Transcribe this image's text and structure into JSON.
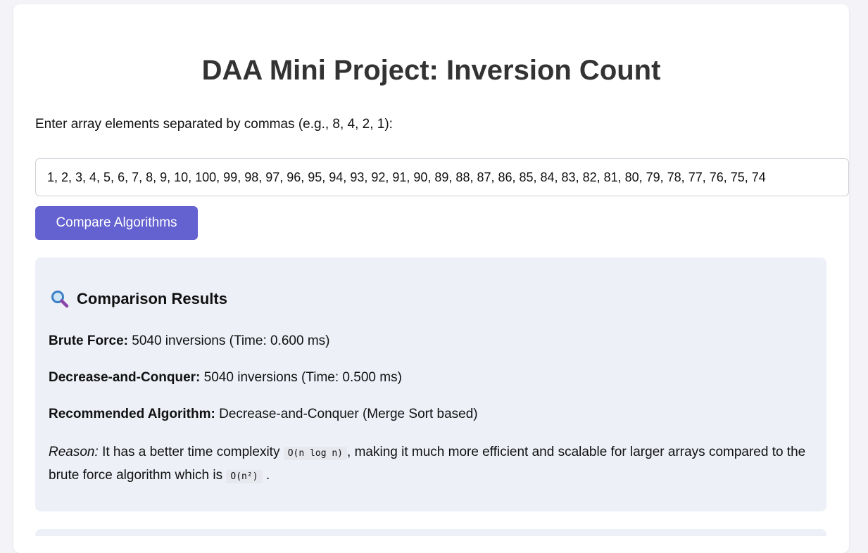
{
  "page": {
    "title": "DAA Mini Project: Inversion Count",
    "prompt": "Enter array elements separated by commas (e.g., 8, 4, 2, 1):",
    "array_value": "1, 2, 3, 4, 5, 6, 7, 8, 9, 10, 100, 99, 98, 97, 96, 95, 94, 93, 92, 91, 90, 89, 88, 87, 86, 85, 84, 83, 82, 81, 80, 79, 78, 77, 76, 75, 74",
    "compare_button": "Compare Algorithms"
  },
  "results": {
    "title": "Comparison Results",
    "title_icon": "magnifying-glass-icon",
    "brute_label": "Brute Force:",
    "brute_value": "5040 inversions (Time: 0.600 ms)",
    "dc_label": "Decrease-and-Conquer:",
    "dc_value": "5040 inversions (Time: 0.500 ms)",
    "recommended_label": "Recommended Algorithm:",
    "recommended_value": "Decrease-and-Conquer (Merge Sort based)",
    "reason_label": "Reason:",
    "reason_text_1": "It has a better time complexity",
    "reason_code_1": "O(n log n)",
    "reason_text_2": ", making it much more efficient and scalable for larger arrays compared to the brute force algorithm which is",
    "reason_code_2": "O(n²)",
    "reason_text_3": "."
  },
  "colors": {
    "accent": "#6461d0",
    "panel": "#edf0f7",
    "background": "#f3f3f8"
  }
}
